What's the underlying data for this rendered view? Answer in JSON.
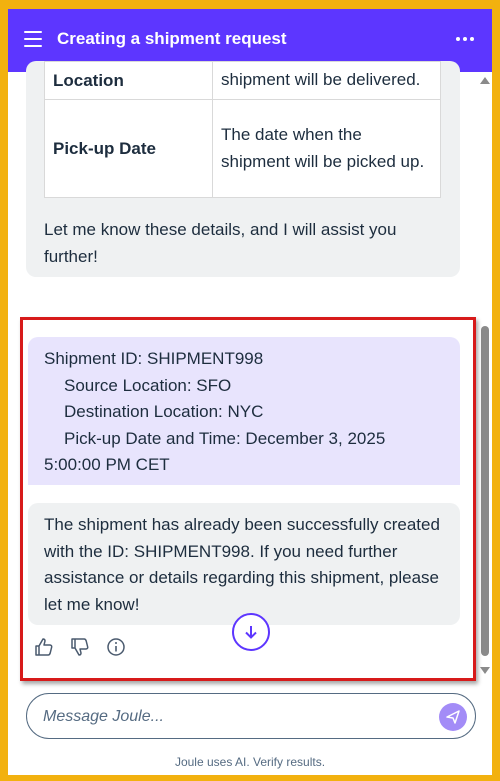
{
  "header": {
    "title": "Creating a shipment request",
    "menu_icon": "hamburger-menu-icon",
    "more_icon": "overflow-dots-icon"
  },
  "top_card": {
    "table": [
      {
        "key": "Location",
        "value": "shipment will be delivered."
      },
      {
        "key": "Pick-up Date",
        "value": "The date when the shipment will be picked up."
      }
    ],
    "message": "Let me know these details, and I will assist you further!"
  },
  "user_message": {
    "line1": "Shipment ID: SHIPMENT998",
    "line2": "Source Location: SFO",
    "line3": "Destination Location: NYC",
    "line4": "Pick-up Date and Time: December 3, 2025",
    "line5": "5:00:00 PM CET"
  },
  "bot_message": {
    "text": "The shipment has already been successfully created with the ID: SHIPMENT998. If you need further assistance or details regarding this shipment, please let me know!"
  },
  "actions": {
    "like_icon": "thumbs-up-icon",
    "dislike_icon": "thumbs-down-icon",
    "info_icon": "info-icon",
    "scroll_icon": "arrow-down-icon"
  },
  "input": {
    "placeholder": "Message Joule...",
    "value": ""
  },
  "footer": {
    "disclaimer": "Joule uses AI. Verify results."
  },
  "colors": {
    "brand": "#5d36ff",
    "highlight_border": "#d71a1a",
    "user_bubble": "#e8e4fd",
    "bot_bubble": "#eff1f2",
    "page_border": "#f2b10f"
  }
}
